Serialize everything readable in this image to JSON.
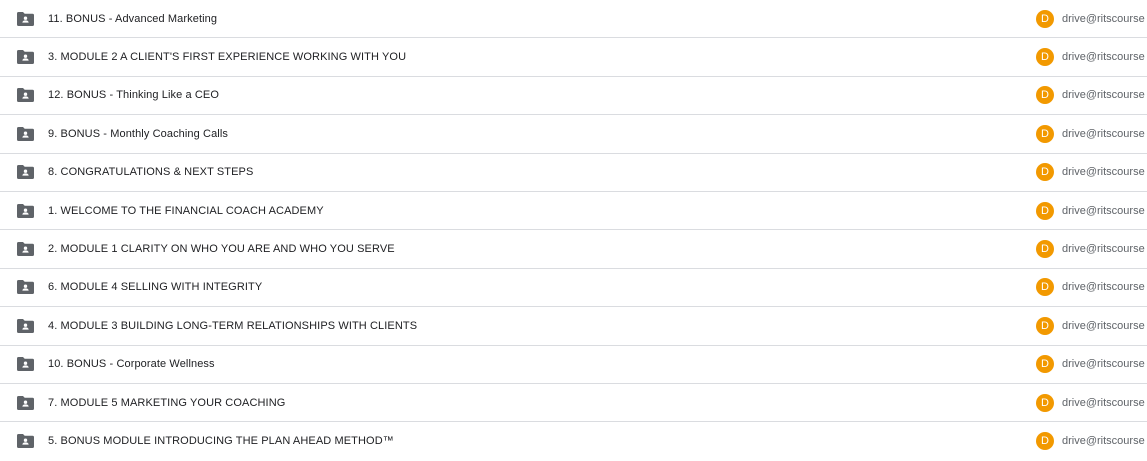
{
  "rows": [
    {
      "name": "11. BONUS - Advanced Marketing",
      "owner_initial": "D",
      "owner": "drive@ritscourse"
    },
    {
      "name": "3. MODULE 2 A CLIENT'S FIRST EXPERIENCE WORKING WITH YOU",
      "owner_initial": "D",
      "owner": "drive@ritscourse"
    },
    {
      "name": "12. BONUS - Thinking Like a CEO",
      "owner_initial": "D",
      "owner": "drive@ritscourse"
    },
    {
      "name": "9. BONUS - Monthly Coaching Calls",
      "owner_initial": "D",
      "owner": "drive@ritscourse"
    },
    {
      "name": "8. CONGRATULATIONS & NEXT STEPS",
      "owner_initial": "D",
      "owner": "drive@ritscourse"
    },
    {
      "name": "1. WELCOME TO THE FINANCIAL COACH ACADEMY",
      "owner_initial": "D",
      "owner": "drive@ritscourse"
    },
    {
      "name": "2. MODULE 1 CLARITY ON WHO YOU ARE AND WHO YOU SERVE",
      "owner_initial": "D",
      "owner": "drive@ritscourse"
    },
    {
      "name": "6. MODULE 4 SELLING WITH INTEGRITY",
      "owner_initial": "D",
      "owner": "drive@ritscourse"
    },
    {
      "name": "4. MODULE 3 BUILDING LONG-TERM RELATIONSHIPS WITH CLIENTS",
      "owner_initial": "D",
      "owner": "drive@ritscourse"
    },
    {
      "name": "10. BONUS - Corporate Wellness",
      "owner_initial": "D",
      "owner": "drive@ritscourse"
    },
    {
      "name": "7. MODULE 5 MARKETING YOUR COACHING",
      "owner_initial": "D",
      "owner": "drive@ritscourse"
    },
    {
      "name": "5. BONUS MODULE INTRODUCING THE PLAN AHEAD METHOD™",
      "owner_initial": "D",
      "owner": "drive@ritscourse"
    }
  ],
  "icons": {
    "folder": "shared-folder-icon"
  },
  "colors": {
    "avatar": "#f29900",
    "divider": "#dadce0",
    "folder": "#5f6368"
  }
}
